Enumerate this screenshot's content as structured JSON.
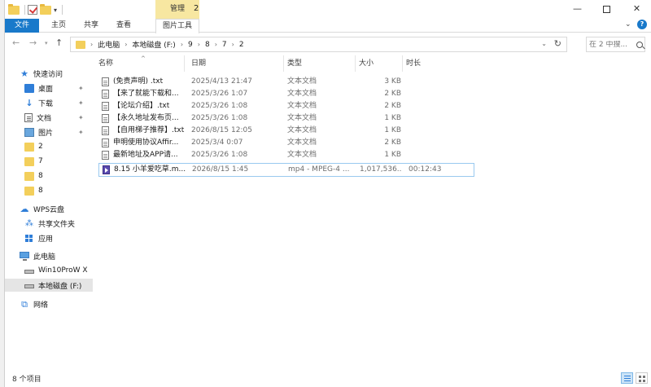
{
  "window": {
    "title": "2",
    "manage_label": "管理",
    "controls": {
      "minimize": "—",
      "close": "✕"
    }
  },
  "ribbon": {
    "tabs": [
      "文件",
      "主页",
      "共享",
      "查看",
      "图片工具"
    ],
    "expand_glyph": "⌄",
    "help_glyph": "?"
  },
  "address": {
    "breadcrumbs": [
      "此电脑",
      "本地磁盘 (F:)",
      "9",
      "8",
      "7",
      "2"
    ],
    "search_placeholder": "在 2 中搜..."
  },
  "nav": {
    "items": [
      {
        "label": "快速访问",
        "icon": "star-icon",
        "pinned": false
      },
      {
        "label": "桌面",
        "icon": "desktop-icon",
        "pinned": true
      },
      {
        "label": "下载",
        "icon": "download-icon",
        "pinned": true
      },
      {
        "label": "文档",
        "icon": "document-icon",
        "pinned": true
      },
      {
        "label": "图片",
        "icon": "pictures-icon",
        "pinned": true
      },
      {
        "label": "2",
        "icon": "folder-icon",
        "pinned": false
      },
      {
        "label": "7",
        "icon": "folder-icon",
        "pinned": false
      },
      {
        "label": "8",
        "icon": "folder-icon",
        "pinned": false
      },
      {
        "label": "8",
        "icon": "folder-icon",
        "pinned": false
      },
      {
        "label": "WPS云盘",
        "icon": "cloud-icon",
        "pinned": false
      },
      {
        "label": "共享文件夹",
        "icon": "share-icon",
        "pinned": false
      },
      {
        "label": "应用",
        "icon": "apps-icon",
        "pinned": false
      },
      {
        "label": "此电脑",
        "icon": "computer-icon",
        "pinned": false
      },
      {
        "label": "Win10ProW X",
        "icon": "drive-icon",
        "pinned": false
      },
      {
        "label": "本地磁盘 (F:)",
        "icon": "drive-icon",
        "pinned": false,
        "selected": true
      },
      {
        "label": "网络",
        "icon": "network-icon",
        "pinned": false
      }
    ]
  },
  "table": {
    "columns": [
      "名称",
      "日期",
      "类型",
      "大小",
      "时长"
    ],
    "rows": [
      {
        "name": "(免责声明) .txt",
        "date": "2025/4/13 21:47",
        "type": "文本文档",
        "size": "3 KB",
        "duration": ""
      },
      {
        "name": "【来了就能下载和...",
        "date": "2025/3/26 1:07",
        "type": "文本文档",
        "size": "2 KB",
        "duration": ""
      },
      {
        "name": "【论坛介绍】.txt",
        "date": "2025/3/26 1:08",
        "type": "文本文档",
        "size": "2 KB",
        "duration": ""
      },
      {
        "name": "【永久地址发布页...",
        "date": "2025/3/26 1:08",
        "type": "文本文档",
        "size": "1 KB",
        "duration": ""
      },
      {
        "name": "【自用梯子推荐】.txt",
        "date": "2026/8/15 12:05",
        "type": "文本文档",
        "size": "1 KB",
        "duration": ""
      },
      {
        "name": "申明使用协议Affir...",
        "date": "2025/3/4 0:07",
        "type": "文本文档",
        "size": "2 KB",
        "duration": ""
      },
      {
        "name": "最新地址及APP请...",
        "date": "2025/3/26 1:08",
        "type": "文本文档",
        "size": "1 KB",
        "duration": ""
      },
      {
        "name": "8.15 小羊爱吃草.m...",
        "date": "2026/8/15 1:45",
        "type": "mp4 - MPEG-4 ...",
        "size": "1,017,536...",
        "duration": "00:12:43",
        "selected": true,
        "video": true
      }
    ]
  },
  "status": {
    "item_count": "8 个项目"
  }
}
